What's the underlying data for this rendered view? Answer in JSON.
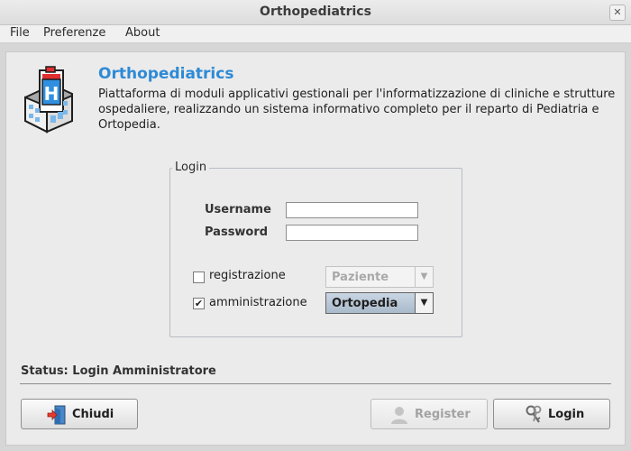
{
  "window": {
    "title": "Orthopediatrics"
  },
  "menu": [
    "File",
    "Preferenze",
    "About"
  ],
  "header": {
    "app_name": "Orthopediatrics",
    "description": "Piattaforma di moduli applicativi gestionali per l'informatizzazione di cliniche e strutture ospedaliere, realizzando un sistema informativo completo per il reparto di Pediatria e Ortopedia."
  },
  "login": {
    "legend": "Login",
    "username_label": "Username",
    "username_value": "",
    "password_label": "Password",
    "password_value": "",
    "registrazione": {
      "label": "registrazione",
      "checked": false,
      "combo_value": "Paziente",
      "enabled": false
    },
    "amministrazione": {
      "label": "amministrazione",
      "checked": true,
      "check_glyph": "✔",
      "combo_value": "Ortopedia",
      "enabled": true
    }
  },
  "status": {
    "text": "Status: Login Amministratore"
  },
  "buttons": {
    "close": {
      "label": "Chiudi",
      "icon": "exit-door-icon"
    },
    "register": {
      "label": "Register",
      "icon": "user-icon",
      "enabled": false
    },
    "login": {
      "label": "Login",
      "icon": "keys-icon"
    }
  },
  "colors": {
    "app_name": "#2d8ad6",
    "active_combo": "#b8c7d7"
  }
}
